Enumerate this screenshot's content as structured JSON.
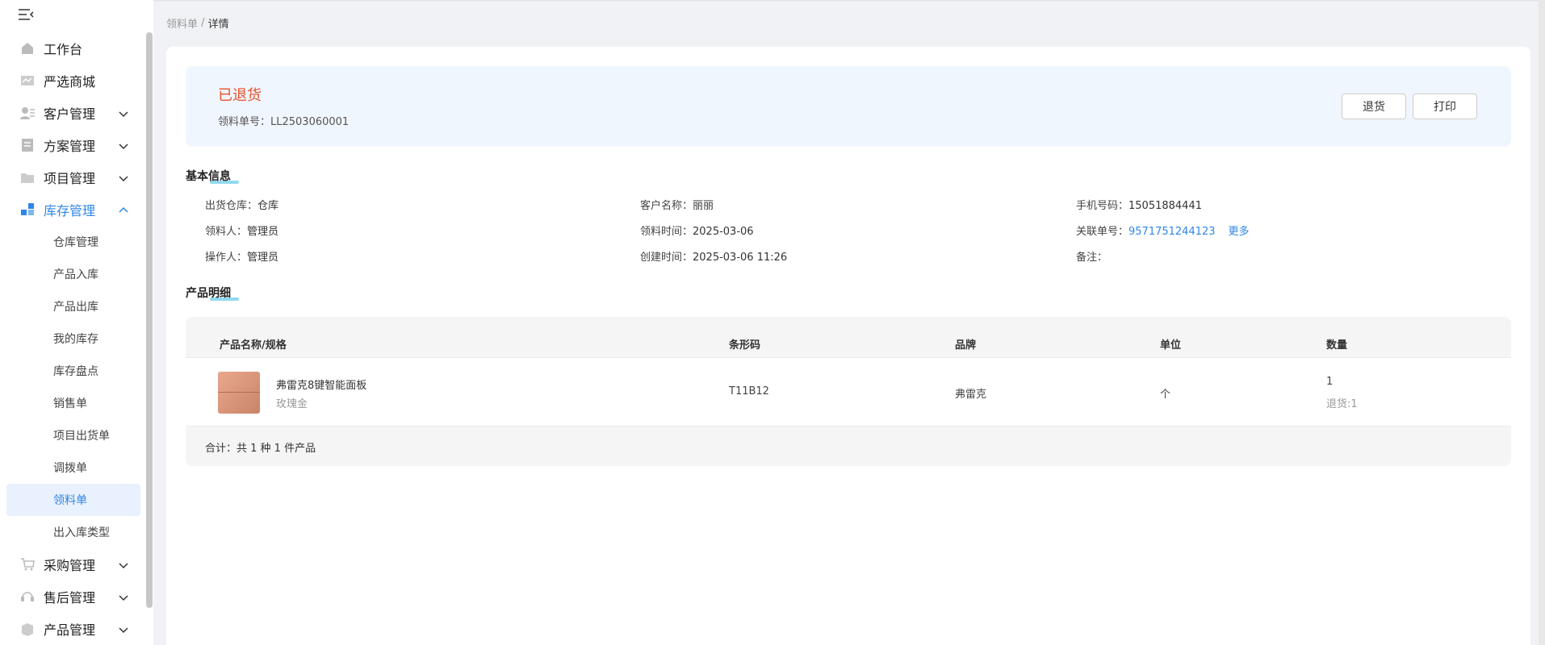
{
  "sidebar": {
    "items": [
      {
        "label": "工作台",
        "icon": "home-icon"
      },
      {
        "label": "严选商城",
        "icon": "shop-icon"
      },
      {
        "label": "客户管理",
        "icon": "customer-icon"
      },
      {
        "label": "方案管理",
        "icon": "plan-icon"
      },
      {
        "label": "项目管理",
        "icon": "folder-icon"
      },
      {
        "label": "库存管理",
        "icon": "inventory-icon"
      },
      {
        "label": "采购管理",
        "icon": "cart-icon"
      },
      {
        "label": "售后管理",
        "icon": "headset-icon"
      },
      {
        "label": "产品管理",
        "icon": "box-icon"
      }
    ],
    "sub_items": [
      "仓库管理",
      "产品入库",
      "产品出库",
      "我的库存",
      "库存盘点",
      "销售单",
      "项目出货单",
      "调拨单",
      "领料单",
      "出入库类型"
    ],
    "active_sub": "领料单",
    "accent": "#2f86e8"
  },
  "breadcrumb": {
    "parent": "领料单",
    "sep": " / ",
    "current": "详情"
  },
  "status": {
    "title": "已退货",
    "order_no": "领料单号：LL2503060001",
    "color": "#e8502a"
  },
  "buttons": {
    "return": "退货",
    "print": "打印"
  },
  "basic": {
    "title": "基本信息",
    "warehouse_label": "出货仓库：",
    "warehouse": "仓库",
    "customer_label": "客户名称：",
    "customer": "丽丽",
    "phone_label": "手机号码：",
    "phone": "15051884441",
    "picker_label": "领料人：",
    "picker": "管理员",
    "pick_time_label": "领料时间：",
    "pick_time": "2025-03-06",
    "related_label": "关联单号：",
    "related": "9571751244123",
    "more": "更多",
    "operator_label": "操作人：",
    "operator": "管理员",
    "created_label": "创建时间：",
    "created": "2025-03-06 11:26",
    "remark_label": "备注："
  },
  "products": {
    "title": "产品明细",
    "headers": [
      "产品名称/规格",
      "条形码",
      "品牌",
      "单位",
      "数量"
    ],
    "rows": [
      {
        "name": "弗雷克8键智能面板",
        "spec": "玫瑰金",
        "barcode": "T11B12",
        "brand": "弗雷克",
        "unit": "个",
        "qty": "1",
        "returned": "退货:1"
      }
    ],
    "summary": "合计：共 1 种 1 件产品"
  }
}
